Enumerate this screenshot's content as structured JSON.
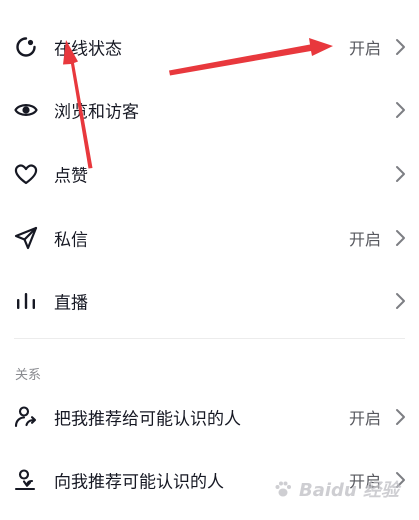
{
  "settings": {
    "items": [
      {
        "label": "在线状态",
        "value": "开启",
        "icon": "online-status-icon"
      },
      {
        "label": "浏览和访客",
        "value": "",
        "icon": "eye-icon"
      },
      {
        "label": "点赞",
        "value": "",
        "icon": "heart-icon"
      },
      {
        "label": "私信",
        "value": "开启",
        "icon": "paper-plane-icon"
      },
      {
        "label": "直播",
        "value": "",
        "icon": "bars-icon"
      }
    ],
    "relations": {
      "section_title": "关系",
      "items": [
        {
          "label": "把我推荐给可能认识的人",
          "value": "开启",
          "icon": "person-share-icon"
        },
        {
          "label": "向我推荐可能认识的人",
          "value": "开启",
          "icon": "person-recommend-icon"
        }
      ]
    }
  },
  "annotation": {
    "arrow_color": "#e8383d"
  },
  "watermark": {
    "text": "Baidu 经验"
  }
}
